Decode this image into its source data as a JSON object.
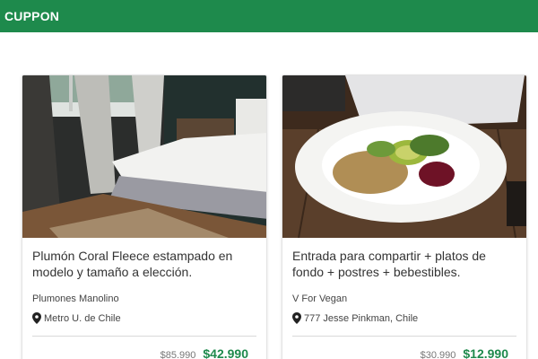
{
  "brand": "CUPPON",
  "colors": {
    "nav_bg": "#1e8a4c",
    "price_green": "#1e8a4c"
  },
  "deals": [
    {
      "image": "bedroom-bed-photo",
      "title": "Plumón Coral Fleece estampado en modelo y tamaño a elección.",
      "merchant": "Plumones Manolino",
      "location": "Metro U. de Chile",
      "location_icon": "map-marker-icon",
      "old_price": "$85.990",
      "price": "$42.990"
    },
    {
      "image": "vegan-salad-plate-photo",
      "title": "Entrada para compartir + platos de fondo + postres + bebestibles.",
      "merchant": "V For Vegan",
      "location": "777 Jesse Pinkman, Chile",
      "location_icon": "map-marker-icon",
      "old_price": "$30.990",
      "price": "$12.990"
    }
  ]
}
